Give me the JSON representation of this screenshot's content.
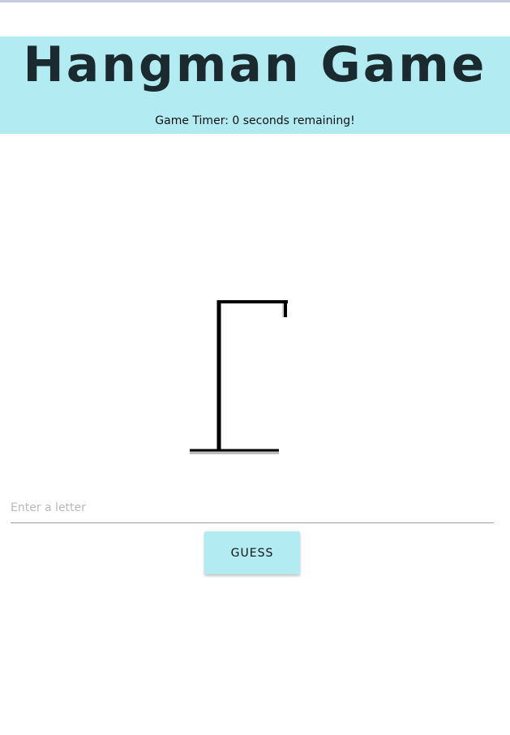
{
  "header": {
    "title": "Hangman Game",
    "timer_text": "Game Timer: 0 seconds remaining!",
    "background_color": "#b2ebf2"
  },
  "gallows": {
    "icon": "hangman-gallows-icon",
    "wrong_guesses_drawn": 0
  },
  "guess_form": {
    "input_placeholder": "Enter a letter",
    "input_value": "",
    "button_label": "GUESS",
    "button_color": "#b2ebf2"
  }
}
